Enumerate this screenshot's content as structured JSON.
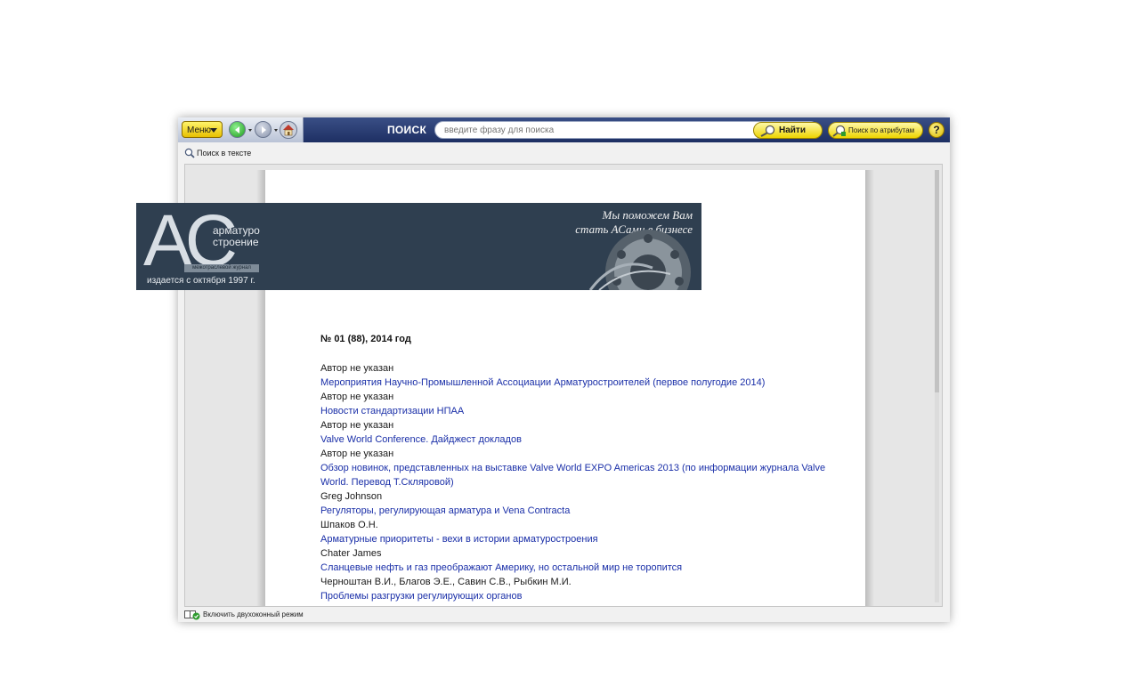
{
  "toolbar": {
    "menu_label": "Меню",
    "search_label": "ПОИСК",
    "search_placeholder": "введите фразу для поиска",
    "find_label": "Найти",
    "attr_search_label": "Поиск по атрибутам",
    "help_label": "?"
  },
  "subbar": {
    "text_search_label": "Поиск в тексте"
  },
  "banner": {
    "logo_letters": "AC",
    "logo_line1": "арматуро",
    "logo_line2": "строение",
    "logo_tag": "межотраслевой журнал",
    "since": "издается с октября 1997 г.",
    "slogan_line1": "Мы поможем Вам",
    "slogan_line2": "стать АСами в бизнесе"
  },
  "issue_title": "№ 01 (88), 2014 год",
  "articles": [
    {
      "author": "Автор не указан",
      "title": "Мероприятия Научно-Промышленной Ассоциации Арматуростроителей (первое полугодие 2014)"
    },
    {
      "author": "Автор не указан",
      "title": "Новости стандартизации НПАА"
    },
    {
      "author": "Автор не указан",
      "title": "Valve World Conference. Дайджест докладов"
    },
    {
      "author": "Автор не указан",
      "title": "Обзор новинок, представленных на выставке Valve World EXPO Americas 2013 (по информации журнала Valve World. Перевод Т.Скляровой)"
    },
    {
      "author": "Greg Johnson",
      "title": "Регуляторы, регулирующая арматура и Vena Contracta"
    },
    {
      "author": "Шпаков О.Н.",
      "title": "Арматурные приоритеты - вехи в истории арматуростроения"
    },
    {
      "author": "Chater James",
      "title": "Сланцевые нефть и газ преображают Америку, но остальной мир не торопится"
    },
    {
      "author": "Черноштан В.И., Благов Э.Е., Савин С.В., Рыбкин М.И.",
      "title": "Проблемы разгрузки регулирующих органов"
    }
  ],
  "status": {
    "dual_window_label": "Включить двухоконный режим"
  }
}
